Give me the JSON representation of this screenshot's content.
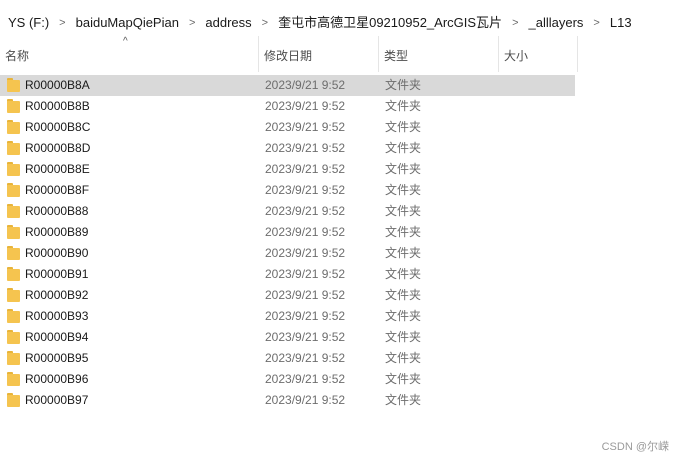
{
  "breadcrumb": [
    "YS (F:)",
    "baiduMapQiePian",
    "address",
    "奎屯市高德卫星09210952_ArcGIS瓦片",
    "_alllayers",
    "L13"
  ],
  "breadcrumb_separator": ">",
  "columns": {
    "name": "名称",
    "date": "修改日期",
    "type": "类型",
    "size": "大小"
  },
  "sort_indicator": "^",
  "files": [
    {
      "name": "R00000B8A",
      "date": "2023/9/21 9:52",
      "type": "文件夹"
    },
    {
      "name": "R00000B8B",
      "date": "2023/9/21 9:52",
      "type": "文件夹"
    },
    {
      "name": "R00000B8C",
      "date": "2023/9/21 9:52",
      "type": "文件夹"
    },
    {
      "name": "R00000B8D",
      "date": "2023/9/21 9:52",
      "type": "文件夹"
    },
    {
      "name": "R00000B8E",
      "date": "2023/9/21 9:52",
      "type": "文件夹"
    },
    {
      "name": "R00000B8F",
      "date": "2023/9/21 9:52",
      "type": "文件夹"
    },
    {
      "name": "R00000B88",
      "date": "2023/9/21 9:52",
      "type": "文件夹"
    },
    {
      "name": "R00000B89",
      "date": "2023/9/21 9:52",
      "type": "文件夹"
    },
    {
      "name": "R00000B90",
      "date": "2023/9/21 9:52",
      "type": "文件夹"
    },
    {
      "name": "R00000B91",
      "date": "2023/9/21 9:52",
      "type": "文件夹"
    },
    {
      "name": "R00000B92",
      "date": "2023/9/21 9:52",
      "type": "文件夹"
    },
    {
      "name": "R00000B93",
      "date": "2023/9/21 9:52",
      "type": "文件夹"
    },
    {
      "name": "R00000B94",
      "date": "2023/9/21 9:52",
      "type": "文件夹"
    },
    {
      "name": "R00000B95",
      "date": "2023/9/21 9:52",
      "type": "文件夹"
    },
    {
      "name": "R00000B96",
      "date": "2023/9/21 9:52",
      "type": "文件夹"
    },
    {
      "name": "R00000B97",
      "date": "2023/9/21 9:52",
      "type": "文件夹"
    }
  ],
  "selected_index": 0,
  "watermark": "CSDN @尔嵘",
  "colors": {
    "folder": "#f5c44f",
    "selection": "#d9d9d9"
  }
}
